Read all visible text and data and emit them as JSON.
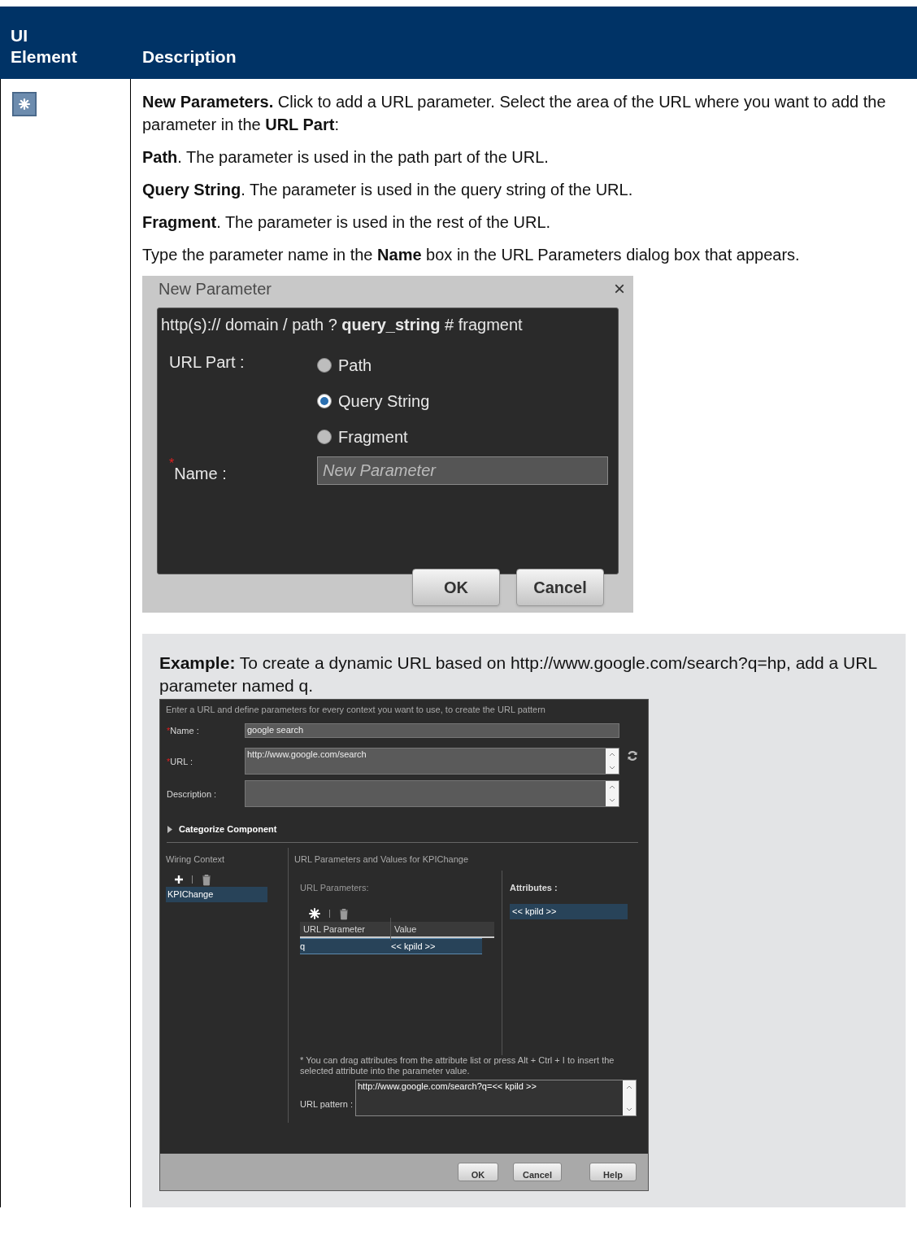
{
  "table": {
    "columns": [
      "UI Element",
      "Description"
    ],
    "rows": [
      {
        "description": [
          "**New Parameters.** Click to add a URL parameter. Select the area of the URL where you want to add the parameter in the **URL Part**:",
          "**Path**. The parameter is used in the path part of the URL.",
          "**Query String**. The parameter is used in the query string of the URL.",
          "**Fragment**. The parameter is used in the rest of the URL.",
          "Type the parameter name in the **Name** box in the URL Parameters dialog box that appears."
        ],
        "dialog": {
          "title": "New Parameter",
          "close": "×",
          "hint": "http(s):// domain / path ? **query_string** # fragment",
          "url_part_label": "URL Part :",
          "radios": [
            {
              "label": "Path",
              "selected": false
            },
            {
              "label": "Query String",
              "selected": true
            },
            {
              "label": "Fragment",
              "selected": false
            }
          ],
          "name_mark": "*",
          "name_label": "Name :",
          "name_field": {
            "placeholder": "New Parameter"
          },
          "buttons": [
            "OK",
            "Cancel"
          ]
        },
        "example": {
          "text": "**Example:** To create a dynamic URL based on http://www.google.com/search?q=hp, add a URL parameter named q.",
          "screenshot": {
            "intro": "Enter a URL and define parameters for every context you want to use, to create the URL pattern",
            "fields": [
              {
                "kind": "text",
                "mark": "*",
                "label": "Name :",
                "value": "google search"
              },
              {
                "kind": "textarea",
                "mark": "*",
                "label": "URL :",
                "value": "http://www.google.com/search"
              },
              {
                "kind": "textarea",
                "label": "Description :"
              }
            ],
            "section": {
              "label": "Categorize Component",
              "expanded": false
            },
            "wiring": {
              "title": "Wiring Context",
              "items": [
                {
                  "label": "KPIChange",
                  "selected": true
                }
              ]
            },
            "params": {
              "title": "URL Parameters and Values for KPIChange",
              "subtitle": "URL Parameters:",
              "columns": [
                "URL Parameter",
                "Value"
              ],
              "rows": [
                {
                  "cells": [
                    "q",
                    "<< kpild >>"
                  ],
                  "selected": true
                }
              ]
            },
            "attributes": {
              "title": "Attributes :",
              "items": [
                {
                  "label": "<< kpild >>",
                  "selected": true
                }
              ]
            },
            "note": "* You can drag attributes from the attribute list or press Alt + Ctrl + I to insert the selected attribute into the parameter value.",
            "pattern": {
              "label": "URL pattern :",
              "value": "http://www.google.com/search?q=<< kpild >>"
            },
            "buttons": [
              "OK",
              "Cancel",
              "Help"
            ]
          }
        }
      }
    ]
  }
}
